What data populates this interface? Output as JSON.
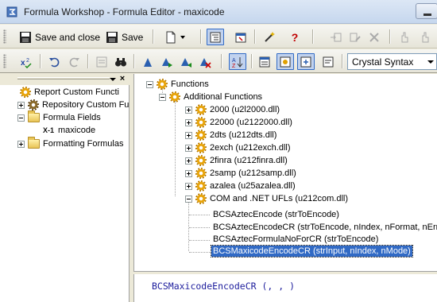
{
  "window": {
    "title": "Formula Workshop - Formula Editor - maxicode"
  },
  "toolbar1": {
    "save_close_label": "Save and close",
    "save_label": "Save"
  },
  "toolbar2": {
    "syntax_value": "Crystal Syntax"
  },
  "left_tree": {
    "items": [
      {
        "label": "Report Custom Functi",
        "icon": "gear-icon"
      },
      {
        "label": "Repository Custom Fu",
        "icon": "gear-icon"
      },
      {
        "label": "Formula Fields",
        "icon": "folder-open-icon"
      },
      {
        "label": "maxicode",
        "icon": "formula-x1-icon",
        "icon_text": "X-1"
      },
      {
        "label": "Formatting Formulas",
        "icon": "folder-icon"
      }
    ]
  },
  "functions_tree": {
    "root_label": "Functions",
    "additional_label": "Additional Functions",
    "libraries": [
      {
        "label": "2000 (u2l2000.dll)"
      },
      {
        "label": "22000 (u2122000.dll)"
      },
      {
        "label": "2dts (u212dts.dll)"
      },
      {
        "label": "2exch (u212exch.dll)"
      },
      {
        "label": "2finra (u212finra.dll)"
      },
      {
        "label": "2samp (u212samp.dll)"
      },
      {
        "label": "azalea (u25azalea.dll)"
      },
      {
        "label": "COM and .NET UFLs (u212com.dll)"
      }
    ],
    "functions": [
      {
        "label": "BCSAztecEncode (strToEncode)"
      },
      {
        "label": "BCSAztecEncodeCR (strToEncode, nIndex, nFormat, nError"
      },
      {
        "label": "BCSAztecFormulaNoForCR (strToEncode)"
      },
      {
        "label": "BCSMaxicodeEncodeCR (strInput, nIndex, nMode)"
      }
    ]
  },
  "editor": {
    "text": "BCSMaxicodeEncodeCR (, , )"
  },
  "colors": {
    "selection": "#316AC5",
    "editor_text": "#1C1C9C"
  }
}
